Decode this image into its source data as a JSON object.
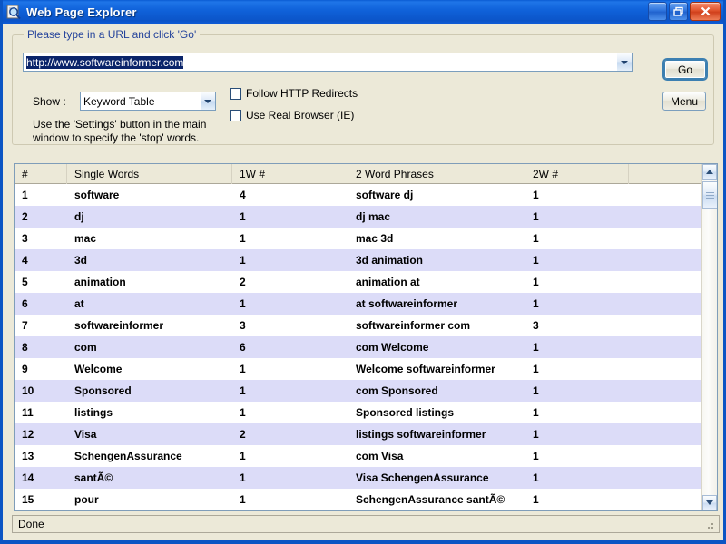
{
  "window": {
    "title": "Web Page Explorer",
    "icon": "magnifier-page-icon",
    "minimize_label": "_",
    "maximize_label": "❐",
    "close_label": "✕",
    "accent_color": "#0B55C4",
    "face_color": "#ECE9D8"
  },
  "groupbox": {
    "legend": "Please type in a URL and click 'Go'",
    "legend_color": "#24439B"
  },
  "url_field": {
    "value": "http://www.softwareinformer.com",
    "selected": true,
    "selection_color": "#0A246A"
  },
  "show": {
    "label": "Show :",
    "value": "Keyword Table"
  },
  "hint": "Use the 'Settings' button in the main window to specify the 'stop' words.",
  "checkboxes": [
    {
      "label": "Follow HTTP Redirects",
      "checked": false
    },
    {
      "label": "Use Real Browser (IE)",
      "checked": false
    }
  ],
  "buttons": {
    "go": "Go",
    "menu": "Menu"
  },
  "table": {
    "columns": [
      "#",
      "Single Words",
      "1W #",
      "2 Word Phrases",
      "2W #",
      ""
    ],
    "row_alt_color": "#DCDCF8",
    "rows": [
      [
        "1",
        "software",
        "4",
        "software dj",
        "1",
        ""
      ],
      [
        "2",
        "dj",
        "1",
        "dj mac",
        "1",
        ""
      ],
      [
        "3",
        "mac",
        "1",
        "mac 3d",
        "1",
        ""
      ],
      [
        "4",
        "3d",
        "1",
        "3d animation",
        "1",
        ""
      ],
      [
        "5",
        "animation",
        "2",
        "animation at",
        "1",
        ""
      ],
      [
        "6",
        "at",
        "1",
        "at softwareinformer",
        "1",
        ""
      ],
      [
        "7",
        "softwareinformer",
        "3",
        "softwareinformer com",
        "3",
        ""
      ],
      [
        "8",
        "com",
        "6",
        "com Welcome",
        "1",
        ""
      ],
      [
        "9",
        "Welcome",
        "1",
        "Welcome softwareinformer",
        "1",
        ""
      ],
      [
        "10",
        "Sponsored",
        "1",
        "com Sponsored",
        "1",
        ""
      ],
      [
        "11",
        "listings",
        "1",
        "Sponsored listings",
        "1",
        ""
      ],
      [
        "12",
        "Visa",
        "2",
        "listings softwareinformer",
        "1",
        ""
      ],
      [
        "13",
        "SchengenAssurance",
        "1",
        "com Visa",
        "1",
        ""
      ],
      [
        "14",
        "santÃ©",
        "1",
        "Visa SchengenAssurance",
        "1",
        ""
      ],
      [
        "15",
        "pour",
        "1",
        "SchengenAssurance santÃ©",
        "1",
        ""
      ]
    ]
  },
  "scrollbar": {
    "up_icon": "chevron-up-icon",
    "down_icon": "chevron-down-icon",
    "thumb_position_percent": 2
  },
  "statusbar": {
    "text": "Done"
  }
}
